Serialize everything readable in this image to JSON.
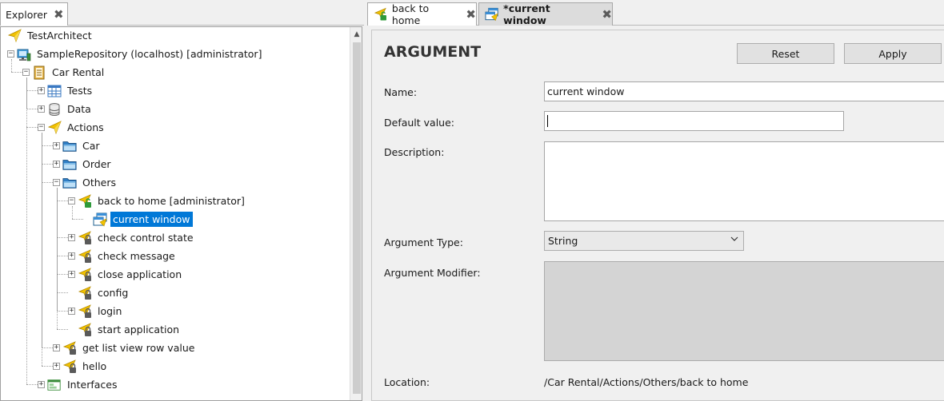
{
  "explorer": {
    "tab_label": "Explorer",
    "tab_close": "✖",
    "tree": [
      {
        "label": "TestArchitect",
        "icon": "testarchitect-icon",
        "level": 0,
        "expander": ""
      },
      {
        "label": "SampleRepository (localhost) [administrator]",
        "icon": "repository-icon",
        "level": 0,
        "expander": "−"
      },
      {
        "label": "Car Rental",
        "icon": "project-icon",
        "level": 1,
        "expander": "−"
      },
      {
        "label": "Tests",
        "icon": "tests-table-icon",
        "level": 2,
        "expander": "+"
      },
      {
        "label": "Data",
        "icon": "database-icon",
        "level": 2,
        "expander": "+"
      },
      {
        "label": "Actions",
        "icon": "actions-icon",
        "level": 2,
        "expander": "−"
      },
      {
        "label": "Car",
        "icon": "folder-icon",
        "level": 3,
        "expander": "+"
      },
      {
        "label": "Order",
        "icon": "folder-icon",
        "level": 3,
        "expander": "+"
      },
      {
        "label": "Others",
        "icon": "folder-icon",
        "level": 3,
        "expander": "−"
      },
      {
        "label": "back to home [administrator]",
        "icon": "action-unlocked-icon",
        "level": 4,
        "expander": "−"
      },
      {
        "label": "current window",
        "icon": "argument-window-icon",
        "level": 5,
        "expander": "",
        "selected": true
      },
      {
        "label": "check control state",
        "icon": "action-locked-icon",
        "level": 4,
        "expander": "+"
      },
      {
        "label": "check message",
        "icon": "action-locked-icon",
        "level": 4,
        "expander": "+"
      },
      {
        "label": "close application",
        "icon": "action-locked-icon",
        "level": 4,
        "expander": "+"
      },
      {
        "label": "config",
        "icon": "action-locked-icon",
        "level": 4,
        "expander": ""
      },
      {
        "label": "login",
        "icon": "action-locked-icon",
        "level": 4,
        "expander": "+"
      },
      {
        "label": "start application",
        "icon": "action-locked-icon",
        "level": 4,
        "expander": ""
      },
      {
        "label": "get list view row value",
        "icon": "action-locked-icon",
        "level": 3,
        "expander": "+"
      },
      {
        "label": "hello",
        "icon": "action-locked-icon",
        "level": 3,
        "expander": "+"
      },
      {
        "label": "Interfaces",
        "icon": "interfaces-icon",
        "level": 2,
        "expander": "+"
      }
    ]
  },
  "editor": {
    "tabs": [
      {
        "label": "back to home",
        "icon": "action-unlocked-icon",
        "close": "✖",
        "active": false
      },
      {
        "label": "*current window",
        "icon": "argument-window-icon",
        "close": "✖",
        "active": true
      }
    ],
    "heading": "ARGUMENT",
    "reset_label": "Reset",
    "apply_label": "Apply",
    "name_label": "Name:",
    "name_value": "current window",
    "default_value_label": "Default value:",
    "default_value": "",
    "description_label": "Description:",
    "description_value": "",
    "argument_type_label": "Argument Type:",
    "argument_type_value": "String",
    "argument_modifier_label": "Argument Modifier:",
    "location_label": "Location:",
    "location_value": "/Car Rental/Actions/Others/back to home"
  },
  "colors": {
    "selection": "#0078d7",
    "background": "#f0f0f0",
    "tree_background": "#ffffff",
    "readonly_box": "#d4d4d4"
  }
}
